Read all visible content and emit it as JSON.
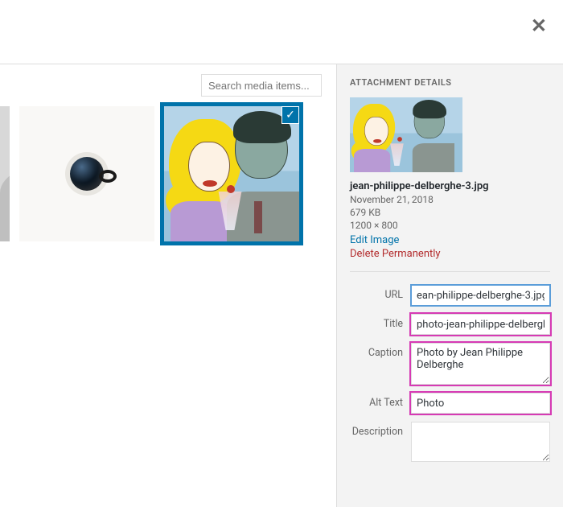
{
  "header": {
    "close_glyph": "✕"
  },
  "search": {
    "placeholder": "Search media items..."
  },
  "thumbnails": {
    "selected_check_glyph": "✓"
  },
  "sidebar": {
    "heading": "ATTACHMENT DETAILS",
    "filename": "jean-philippe-delberghe-3.jpg",
    "date": "November 21, 2018",
    "filesize": "679 KB",
    "dimensions": "1200 × 800",
    "edit_label": "Edit Image",
    "delete_label": "Delete Permanently",
    "fields": {
      "url": {
        "label": "URL",
        "value": "ean-philippe-delberghe-3.jpg"
      },
      "title": {
        "label": "Title",
        "value": "photo-jean-philippe-delbergh"
      },
      "caption": {
        "label": "Caption",
        "value": "Photo by Jean Philippe Delberghe"
      },
      "alt": {
        "label": "Alt Text",
        "value": "Photo"
      },
      "description": {
        "label": "Description",
        "value": ""
      }
    }
  }
}
